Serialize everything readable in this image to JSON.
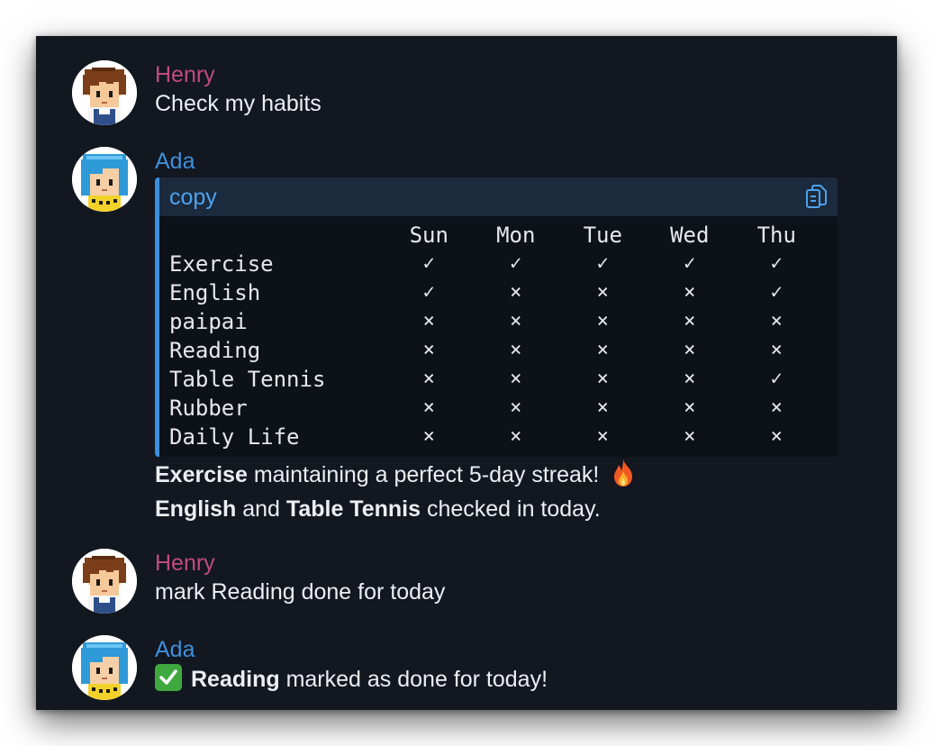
{
  "conversation": {
    "messages": [
      {
        "author": "Henry",
        "text": "Check my habits"
      },
      {
        "author": "Ada",
        "code_block": {
          "label": "copy",
          "copy_icon": "copy-icon",
          "columns": [
            "Sun",
            "Mon",
            "Tue",
            "Wed",
            "Thu"
          ],
          "rows": [
            {
              "name": "Exercise",
              "marks": [
                "✓",
                "✓",
                "✓",
                "✓",
                "✓"
              ]
            },
            {
              "name": "English",
              "marks": [
                "✓",
                "×",
                "×",
                "×",
                "✓"
              ]
            },
            {
              "name": "paipai",
              "marks": [
                "×",
                "×",
                "×",
                "×",
                "×"
              ]
            },
            {
              "name": "Reading",
              "marks": [
                "×",
                "×",
                "×",
                "×",
                "×"
              ]
            },
            {
              "name": "Table Tennis",
              "marks": [
                "×",
                "×",
                "×",
                "×",
                "✓"
              ]
            },
            {
              "name": "Rubber",
              "marks": [
                "×",
                "×",
                "×",
                "×",
                "×"
              ]
            },
            {
              "name": "Daily Life",
              "marks": [
                "×",
                "×",
                "×",
                "×",
                "×"
              ]
            }
          ]
        },
        "summary_line1": {
          "bold": "Exercise",
          "rest": " maintaining a perfect 5-day streak! ",
          "emoji": "fire-icon"
        },
        "summary_line2": {
          "bold1": "English",
          "mid": " and ",
          "bold2": "Table Tennis",
          "rest": " checked in today."
        }
      },
      {
        "author": "Henry",
        "text": "mark Reading done for today"
      },
      {
        "author": "Ada",
        "emoji": "check-mark-button-icon",
        "bold": "Reading",
        "rest": " marked as done for today!"
      }
    ]
  },
  "colors": {
    "background": "#121720",
    "henry_name": "#c04b7e",
    "ada_name": "#3f8fdb",
    "code_accent": "#3b8fdd",
    "code_header": "#1b2a3d"
  }
}
